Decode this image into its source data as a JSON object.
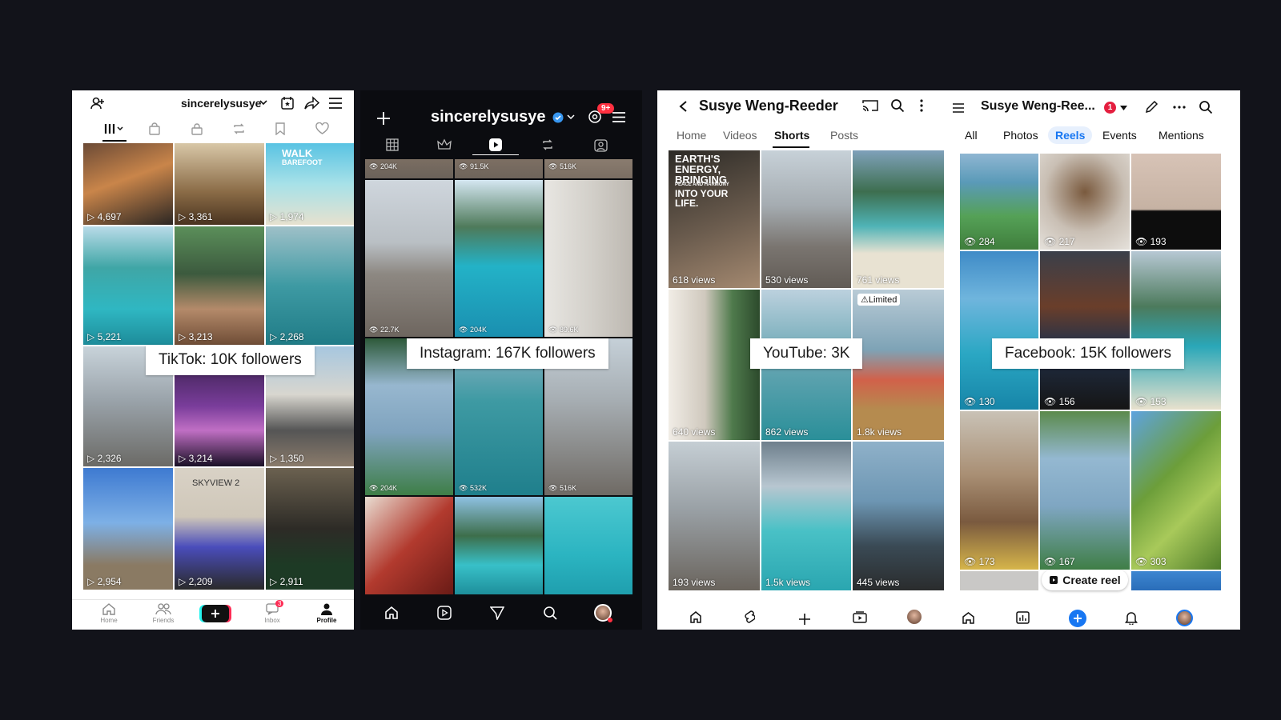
{
  "tiktok": {
    "username": "sincerelysusye",
    "label": "TikTok: 10K followers",
    "counts": [
      "4,697",
      "3,361",
      "1,974",
      "5,221",
      "3,213",
      "2,268",
      "2,326",
      "3,214",
      "1,350",
      "2,954",
      "2,209",
      "2,911"
    ],
    "overlay_walk": "WALK",
    "overlay_barefoot": "BAREFOOT",
    "overlay_skyview": "SKYVIEW 2",
    "nav": {
      "home": "Home",
      "friends": "Friends",
      "inbox": "Inbox",
      "profile": "Profile",
      "inbox_badge": "3"
    }
  },
  "instagram": {
    "username": "sincerelysusye",
    "badge": "9+",
    "label": "Instagram: 167K followers",
    "top_counts": [
      "204K",
      "91.5K",
      "516K"
    ],
    "counts": [
      "22.7K",
      "204K",
      "89.6K",
      "204K",
      "532K",
      "516K"
    ]
  },
  "youtube": {
    "channel": "Susye Weng-Reeder",
    "tabs": [
      "Home",
      "Videos",
      "Shorts",
      "Posts"
    ],
    "active_tab": "Shorts",
    "label": "YouTube: 3K",
    "limited": "Limited",
    "views": [
      "618 views",
      "530 views",
      "761 views",
      "640 views",
      "862 views",
      "1.8k views",
      "193 views",
      "1.5k views",
      "445 views"
    ],
    "overlay_earth": "EARTH'S ENERGY, BRINGING",
    "overlay_peace": "PEACE AND HARMONY",
    "overlay_into": "INTO YOUR LIFE."
  },
  "facebook": {
    "name": "Susye Weng-Ree...",
    "notif": "1",
    "tabs": [
      "All",
      "Photos",
      "Reels",
      "Events",
      "Mentions"
    ],
    "active_tab": "Reels",
    "label": "Facebook: 15K followers",
    "counts": [
      "284",
      "217",
      "193",
      "130",
      "156",
      "153",
      "173",
      "167",
      "303"
    ],
    "create_reel": "Create reel"
  }
}
